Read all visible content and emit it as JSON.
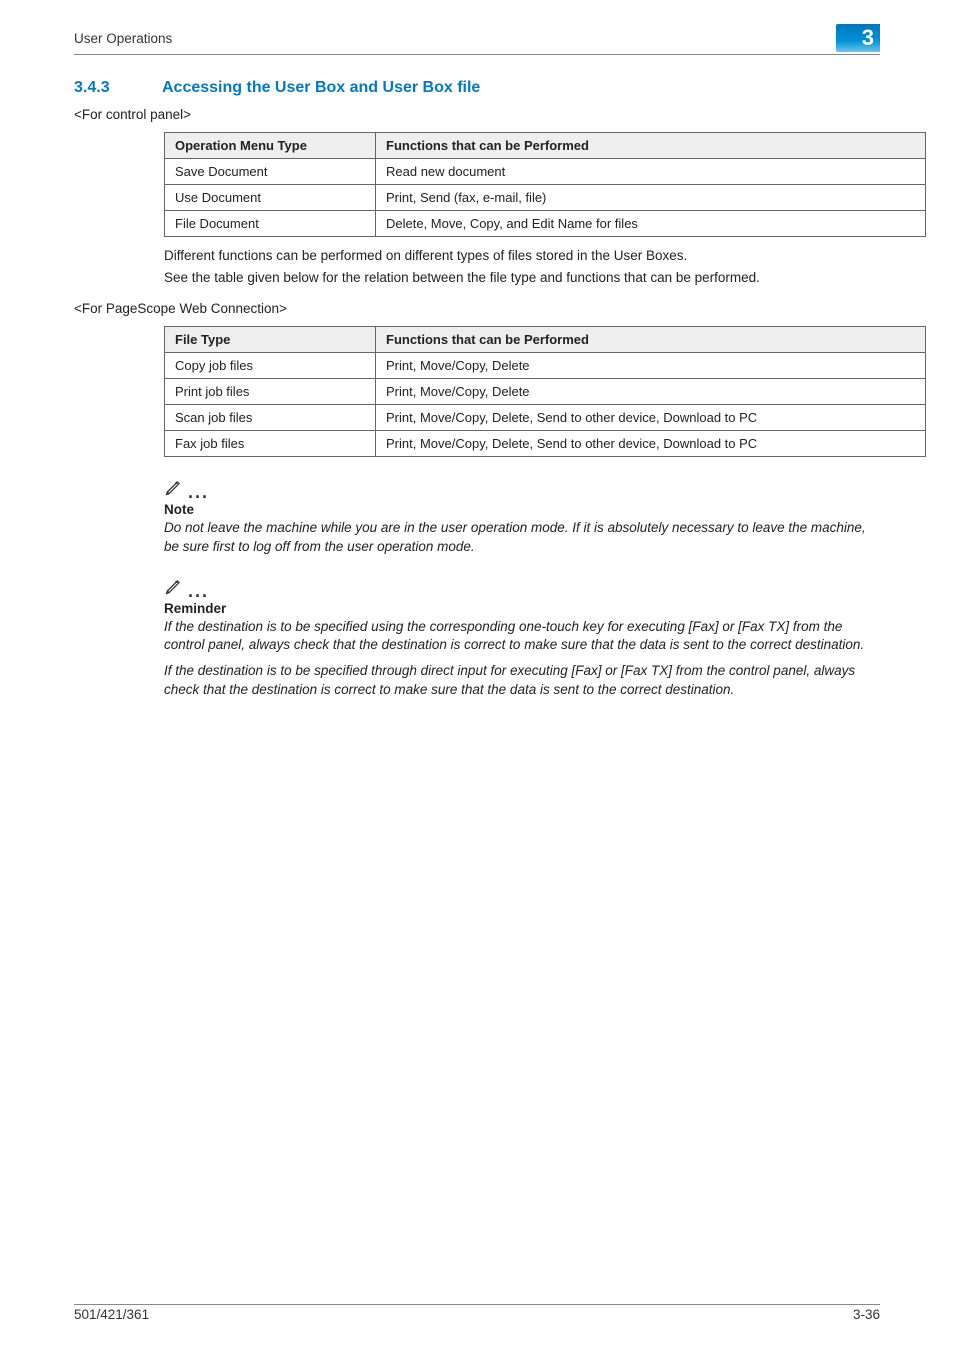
{
  "header": {
    "running_title": "User Operations",
    "chapter_number": "3"
  },
  "section": {
    "number": "3.4.3",
    "title": "Accessing the User Box and User Box file"
  },
  "control_panel": {
    "label": "<For control panel>",
    "col1_header": "Operation Menu Type",
    "col2_header": "Functions that can be Performed",
    "rows": [
      {
        "c1": "Save Document",
        "c2": "Read new document"
      },
      {
        "c1": "Use Document",
        "c2": "Print, Send (fax, e-mail, file)"
      },
      {
        "c1": "File Document",
        "c2": "Delete, Move, Copy, and Edit Name for files"
      }
    ]
  },
  "between_tables": {
    "line1": "Different functions can be performed on different types of files stored in the User Boxes.",
    "line2": "See the table given below for the relation between the file type and functions that can be performed."
  },
  "web_connection": {
    "label": "<For PageScope Web Connection>",
    "col1_header": "File Type",
    "col2_header": "Functions that can be Performed",
    "rows": [
      {
        "c1": "Copy job files",
        "c2": "Print, Move/Copy, Delete"
      },
      {
        "c1": "Print job files",
        "c2": "Print, Move/Copy, Delete"
      },
      {
        "c1": "Scan job files",
        "c2": "Print, Move/Copy, Delete, Send to other device, Download to PC"
      },
      {
        "c1": "Fax job files",
        "c2": "Print, Move/Copy, Delete, Send to other device, Download to PC"
      }
    ]
  },
  "note": {
    "label": "Note",
    "body": "Do not leave the machine while you are in the user operation mode. If it is absolutely necessary to leave the machine, be sure first to log off from the user operation mode."
  },
  "reminder": {
    "label": "Reminder",
    "body1": "If the destination is to be specified using the corresponding one-touch key for executing [Fax] or [Fax TX] from the control panel, always check that the destination is correct to make sure that the data is sent to the correct destination.",
    "body2": "If the destination is to be specified through direct input for executing [Fax] or [Fax TX] from the control panel, always check that the destination is correct to make sure that the data is sent to the correct destination."
  },
  "footer": {
    "left": "501/421/361",
    "right": "3-36"
  }
}
